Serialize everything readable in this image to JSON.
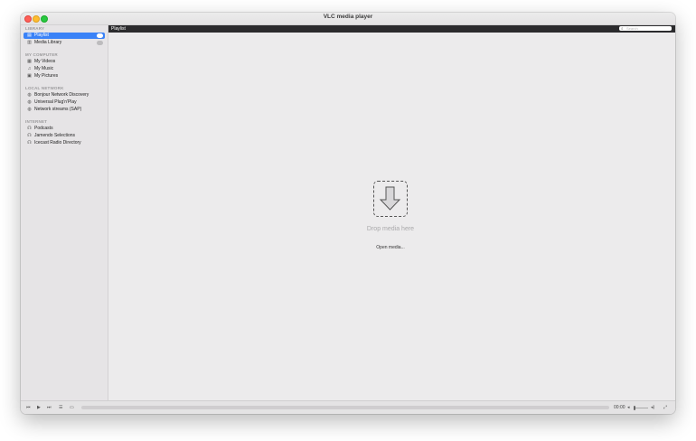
{
  "window": {
    "title": "VLC media player"
  },
  "sidebar": {
    "sections": [
      {
        "label": "LIBRARY",
        "items": [
          {
            "label": "Playlist",
            "icon": "playlist-icon",
            "selected": true
          },
          {
            "label": "Media Library",
            "icon": "library-icon",
            "selected": false
          }
        ]
      },
      {
        "label": "MY COMPUTER",
        "items": [
          {
            "label": "My Videos",
            "icon": "film-icon"
          },
          {
            "label": "My Music",
            "icon": "music-note-icon"
          },
          {
            "label": "My Pictures",
            "icon": "picture-icon"
          }
        ]
      },
      {
        "label": "LOCAL NETWORK",
        "items": [
          {
            "label": "Bonjour Network Discovery",
            "icon": "network-globe-icon"
          },
          {
            "label": "Universal Plug'n'Play",
            "icon": "network-globe-icon"
          },
          {
            "label": "Network streams (SAP)",
            "icon": "network-globe-icon"
          }
        ]
      },
      {
        "label": "INTERNET",
        "items": [
          {
            "label": "Podcasts",
            "icon": "podcast-icon"
          },
          {
            "label": "Jamendo Selections",
            "icon": "podcast-icon"
          },
          {
            "label": "Icecast Radio Directory",
            "icon": "podcast-icon"
          }
        ]
      }
    ]
  },
  "header": {
    "title": "Playlist",
    "search_placeholder": "Search"
  },
  "main": {
    "drop_text": "Drop media here",
    "open_media_label": "Open media..."
  },
  "controls": {
    "time": "00:00",
    "volume_level": 0.1
  },
  "colors": {
    "accent": "#3a82f7",
    "header_bg": "#2b2b2d"
  }
}
